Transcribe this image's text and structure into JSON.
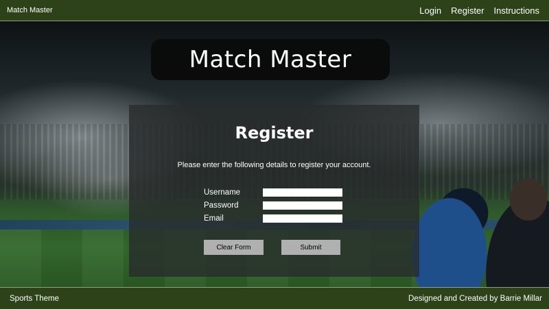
{
  "navbar": {
    "brand": "Match Master",
    "links": [
      "Login",
      "Register",
      "Instructions"
    ]
  },
  "banner": {
    "title": "Match Master"
  },
  "register": {
    "heading": "Register",
    "intro": "Please enter the following details to register your account.",
    "fields": [
      {
        "label": "Username",
        "value": ""
      },
      {
        "label": "Password",
        "value": ""
      },
      {
        "label": "Email",
        "value": ""
      }
    ],
    "clear_label": "Clear Form",
    "submit_label": "Submit"
  },
  "footer": {
    "left": "Sports Theme",
    "right": "Designed and Created by Barrie Millar"
  },
  "colors": {
    "navbar_bg": "#2d4219",
    "panel_bg": "rgba(40,44,44,0.80)",
    "button_bg": "#b0b0b0"
  }
}
